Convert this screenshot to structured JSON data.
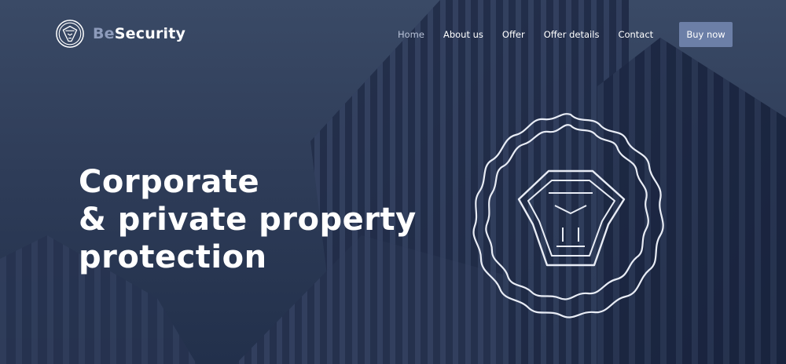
{
  "brand": {
    "name_part1": "Be",
    "name_part2": "Security",
    "logo_icon": "lion-head-icon"
  },
  "nav": {
    "items": [
      {
        "label": "Home",
        "active": true
      },
      {
        "label": "About us",
        "active": false
      },
      {
        "label": "Offer",
        "active": false
      },
      {
        "label": "Offer details",
        "active": false
      },
      {
        "label": "Contact",
        "active": false
      }
    ],
    "cta_label": "Buy now"
  },
  "hero": {
    "headline_lines": [
      "Corporate",
      "& private property",
      "protection"
    ],
    "emblem_icon": "lion-emblem-icon"
  },
  "colors": {
    "overlay": "#2f3d59",
    "accent": "#6c7fa7",
    "brand_muted": "#8d9bbb"
  }
}
